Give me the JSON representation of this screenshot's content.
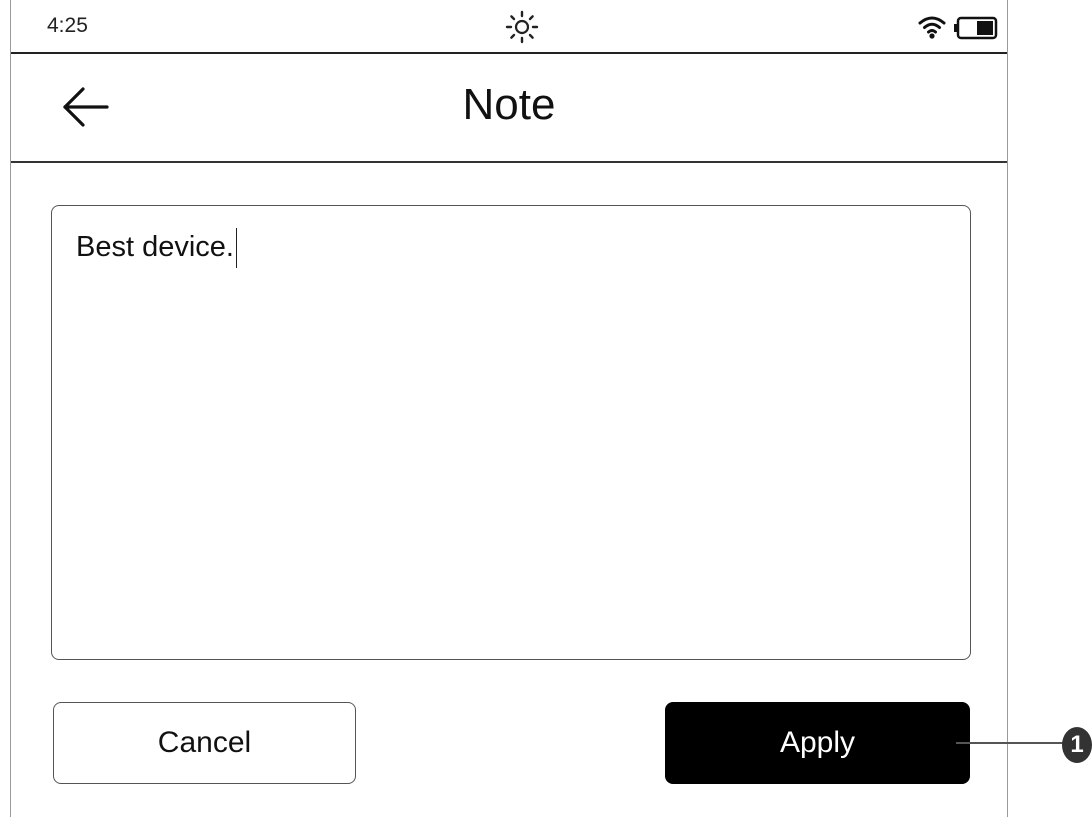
{
  "status_bar": {
    "time": "4:25",
    "icons": {
      "brightness": "sun-icon",
      "wifi": "wifi-icon",
      "battery": "battery-icon"
    }
  },
  "header": {
    "back_icon": "arrow-left-icon",
    "title": "Note"
  },
  "note": {
    "value": "Best device."
  },
  "actions": {
    "cancel_label": "Cancel",
    "apply_label": "Apply"
  },
  "callout": {
    "number": "1"
  },
  "colors": {
    "apply_background": "#000000",
    "apply_text": "#ffffff",
    "border": "#555555"
  }
}
